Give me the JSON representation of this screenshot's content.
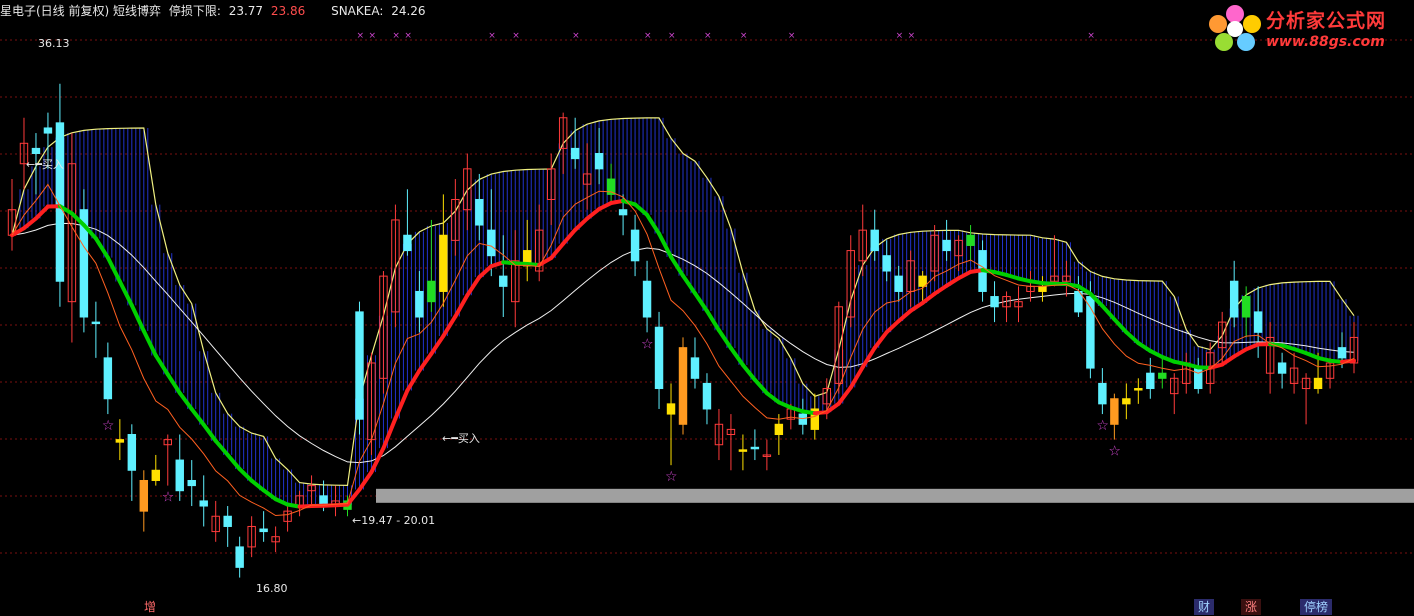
{
  "header": {
    "title": "星电子(日线 前复权) 短线博弈",
    "stop_label": "停损下限:",
    "stop_value_1": "23.77",
    "stop_value_2": "23.86",
    "snake_label": "SNAKEA:",
    "snake_value": "24.26"
  },
  "logo": {
    "brand": "分析家公式网",
    "url": "www.88gs.com"
  },
  "bottom_tabs": {
    "zeng": "增",
    "cai": "财",
    "zhang": "涨",
    "tingpai": "停榜"
  },
  "annotations": {
    "high": "36.13",
    "low": "16.80",
    "buy1": "←━买入",
    "buy2": "←━买入",
    "range": "←19.47 - 20.01"
  },
  "colors": {
    "background": "#000000",
    "up_candle": "#ff3b3b",
    "down_candle": "#5ff0ff",
    "green_band": "#00d000",
    "red_band": "#ff2020",
    "blue_fill": "#2233cc",
    "yellow_line": "#f0f080",
    "white_line": "#f0f0f0",
    "grid": "#7a1010",
    "floor_bar": "#a0a0a0",
    "star": "#cc44cc"
  },
  "chart_data": {
    "type": "candlestick",
    "title": "星电子(日线 前复权) 短线博弈",
    "ylim": [
      16,
      38
    ],
    "grid": true,
    "candles": [
      {
        "o": 31.2,
        "h": 32.4,
        "l": 29.6,
        "c": 30.2,
        "color": "up"
      },
      {
        "o": 33.0,
        "h": 34.8,
        "l": 32.0,
        "c": 33.8,
        "color": "up"
      },
      {
        "o": 33.4,
        "h": 34.2,
        "l": 31.8,
        "c": 33.6,
        "color": "cyan"
      },
      {
        "o": 34.2,
        "h": 35.0,
        "l": 32.8,
        "c": 34.4,
        "color": "cyan"
      },
      {
        "o": 34.6,
        "h": 36.13,
        "l": 27.4,
        "c": 28.4,
        "color": "cyan"
      },
      {
        "o": 33.0,
        "h": 34.2,
        "l": 26.0,
        "c": 27.6,
        "color": "up"
      },
      {
        "o": 31.2,
        "h": 32.0,
        "l": 26.4,
        "c": 27.0,
        "color": "cyan"
      },
      {
        "o": 26.8,
        "h": 27.6,
        "l": 25.4,
        "c": 26.8,
        "color": "cyan"
      },
      {
        "o": 25.4,
        "h": 26.0,
        "l": 23.2,
        "c": 23.8,
        "color": "cyan"
      },
      {
        "o": 22.2,
        "h": 23.0,
        "l": 21.4,
        "c": 22.1,
        "color": "yellow"
      },
      {
        "o": 21.0,
        "h": 22.8,
        "l": 19.8,
        "c": 22.4,
        "color": "cyan"
      },
      {
        "o": 19.4,
        "h": 21.0,
        "l": 18.6,
        "c": 20.6,
        "color": "orange"
      },
      {
        "o": 21.0,
        "h": 21.6,
        "l": 20.4,
        "c": 20.6,
        "color": "yellow"
      },
      {
        "o": 22.0,
        "h": 22.4,
        "l": 20.4,
        "c": 22.2,
        "color": "up"
      },
      {
        "o": 21.4,
        "h": 22.4,
        "l": 19.8,
        "c": 20.2,
        "color": "cyan"
      },
      {
        "o": 20.4,
        "h": 21.4,
        "l": 19.6,
        "c": 20.6,
        "color": "cyan"
      },
      {
        "o": 19.8,
        "h": 20.8,
        "l": 18.8,
        "c": 19.6,
        "color": "cyan"
      },
      {
        "o": 19.2,
        "h": 19.8,
        "l": 18.2,
        "c": 18.6,
        "color": "up"
      },
      {
        "o": 18.8,
        "h": 19.6,
        "l": 18.0,
        "c": 19.2,
        "color": "cyan"
      },
      {
        "o": 17.2,
        "h": 18.4,
        "l": 16.8,
        "c": 18.0,
        "color": "cyan"
      },
      {
        "o": 18.0,
        "h": 19.2,
        "l": 17.6,
        "c": 18.8,
        "color": "up"
      },
      {
        "o": 18.6,
        "h": 19.4,
        "l": 18.2,
        "c": 18.7,
        "color": "cyan"
      },
      {
        "o": 18.4,
        "h": 18.8,
        "l": 17.8,
        "c": 18.2,
        "color": "up"
      },
      {
        "o": 19.0,
        "h": 19.6,
        "l": 18.6,
        "c": 19.4,
        "color": "up"
      },
      {
        "o": 19.6,
        "h": 20.2,
        "l": 19.2,
        "c": 20.0,
        "color": "up"
      },
      {
        "o": 20.2,
        "h": 20.8,
        "l": 19.6,
        "c": 20.4,
        "color": "up"
      },
      {
        "o": 20.0,
        "h": 20.6,
        "l": 19.4,
        "c": 19.6,
        "color": "cyan"
      },
      {
        "o": 19.6,
        "h": 20.4,
        "l": 19.2,
        "c": 19.8,
        "color": "up"
      },
      {
        "o": 19.47,
        "h": 20.01,
        "l": 19.2,
        "c": 19.8,
        "color": "green"
      },
      {
        "o": 23.0,
        "h": 27.6,
        "l": 22.4,
        "c": 27.2,
        "color": "cyan"
      },
      {
        "o": 22.2,
        "h": 25.6,
        "l": 21.6,
        "c": 25.2,
        "color": "up"
      },
      {
        "o": 24.6,
        "h": 28.8,
        "l": 24.0,
        "c": 28.6,
        "color": "up"
      },
      {
        "o": 27.2,
        "h": 31.4,
        "l": 26.6,
        "c": 30.8,
        "color": "up"
      },
      {
        "o": 30.2,
        "h": 32.0,
        "l": 29.4,
        "c": 29.6,
        "color": "cyan"
      },
      {
        "o": 28.0,
        "h": 28.8,
        "l": 26.4,
        "c": 27.0,
        "color": "cyan"
      },
      {
        "o": 27.6,
        "h": 30.8,
        "l": 27.2,
        "c": 28.4,
        "color": "green"
      },
      {
        "o": 28.0,
        "h": 31.8,
        "l": 27.4,
        "c": 30.2,
        "color": "yellow"
      },
      {
        "o": 30.0,
        "h": 32.4,
        "l": 29.4,
        "c": 31.6,
        "color": "up"
      },
      {
        "o": 31.2,
        "h": 33.4,
        "l": 30.4,
        "c": 32.8,
        "color": "up"
      },
      {
        "o": 30.6,
        "h": 32.6,
        "l": 30.0,
        "c": 31.6,
        "color": "cyan"
      },
      {
        "o": 30.4,
        "h": 32.0,
        "l": 28.6,
        "c": 29.4,
        "color": "cyan"
      },
      {
        "o": 28.6,
        "h": 30.2,
        "l": 27.0,
        "c": 28.2,
        "color": "cyan"
      },
      {
        "o": 29.2,
        "h": 30.4,
        "l": 26.6,
        "c": 27.6,
        "color": "up"
      },
      {
        "o": 29.6,
        "h": 30.8,
        "l": 28.4,
        "c": 29.0,
        "color": "yellow"
      },
      {
        "o": 30.4,
        "h": 31.4,
        "l": 28.4,
        "c": 28.8,
        "color": "up"
      },
      {
        "o": 31.6,
        "h": 33.4,
        "l": 30.6,
        "c": 32.8,
        "color": "up"
      },
      {
        "o": 33.6,
        "h": 35.0,
        "l": 32.6,
        "c": 34.8,
        "color": "up"
      },
      {
        "o": 33.6,
        "h": 34.8,
        "l": 32.8,
        "c": 33.2,
        "color": "cyan"
      },
      {
        "o": 32.2,
        "h": 33.8,
        "l": 31.2,
        "c": 32.6,
        "color": "up"
      },
      {
        "o": 33.4,
        "h": 34.4,
        "l": 32.2,
        "c": 32.8,
        "color": "cyan"
      },
      {
        "o": 32.4,
        "h": 33.0,
        "l": 31.4,
        "c": 31.8,
        "color": "green"
      },
      {
        "o": 31.2,
        "h": 31.8,
        "l": 30.2,
        "c": 31.0,
        "color": "cyan"
      },
      {
        "o": 30.4,
        "h": 31.0,
        "l": 28.6,
        "c": 29.2,
        "color": "cyan"
      },
      {
        "o": 28.4,
        "h": 29.2,
        "l": 26.4,
        "c": 27.0,
        "color": "cyan"
      },
      {
        "o": 26.6,
        "h": 27.2,
        "l": 23.4,
        "c": 24.2,
        "color": "cyan"
      },
      {
        "o": 23.6,
        "h": 24.4,
        "l": 21.2,
        "c": 23.2,
        "color": "yellow"
      },
      {
        "o": 22.8,
        "h": 26.2,
        "l": 22.4,
        "c": 25.8,
        "color": "orange"
      },
      {
        "o": 25.4,
        "h": 26.2,
        "l": 24.2,
        "c": 24.6,
        "color": "cyan"
      },
      {
        "o": 24.4,
        "h": 24.8,
        "l": 22.8,
        "c": 23.4,
        "color": "cyan"
      },
      {
        "o": 22.8,
        "h": 23.4,
        "l": 21.4,
        "c": 22.0,
        "color": "up"
      },
      {
        "o": 22.6,
        "h": 23.2,
        "l": 21.0,
        "c": 22.4,
        "color": "up"
      },
      {
        "o": 21.8,
        "h": 22.4,
        "l": 21.0,
        "c": 21.8,
        "color": "yellow"
      },
      {
        "o": 21.9,
        "h": 22.6,
        "l": 21.4,
        "c": 21.9,
        "color": "cyan"
      },
      {
        "o": 21.6,
        "h": 22.2,
        "l": 21.0,
        "c": 21.6,
        "color": "up"
      },
      {
        "o": 22.4,
        "h": 23.2,
        "l": 21.6,
        "c": 22.8,
        "color": "yellow"
      },
      {
        "o": 23.0,
        "h": 23.6,
        "l": 22.6,
        "c": 23.4,
        "color": "up"
      },
      {
        "o": 23.2,
        "h": 23.8,
        "l": 22.4,
        "c": 22.8,
        "color": "cyan"
      },
      {
        "o": 22.6,
        "h": 24.0,
        "l": 22.2,
        "c": 23.4,
        "color": "yellow"
      },
      {
        "o": 23.6,
        "h": 24.6,
        "l": 23.0,
        "c": 24.2,
        "color": "up"
      },
      {
        "o": 24.4,
        "h": 27.6,
        "l": 24.0,
        "c": 27.4,
        "color": "up"
      },
      {
        "o": 27.0,
        "h": 30.2,
        "l": 26.6,
        "c": 29.6,
        "color": "up"
      },
      {
        "o": 29.2,
        "h": 31.4,
        "l": 28.6,
        "c": 30.4,
        "color": "up"
      },
      {
        "o": 30.4,
        "h": 31.2,
        "l": 29.2,
        "c": 29.6,
        "color": "cyan"
      },
      {
        "o": 29.4,
        "h": 30.0,
        "l": 28.4,
        "c": 28.8,
        "color": "cyan"
      },
      {
        "o": 28.6,
        "h": 29.0,
        "l": 27.6,
        "c": 28.0,
        "color": "cyan"
      },
      {
        "o": 28.0,
        "h": 29.6,
        "l": 27.4,
        "c": 29.2,
        "color": "up"
      },
      {
        "o": 28.2,
        "h": 28.8,
        "l": 27.6,
        "c": 28.6,
        "color": "yellow"
      },
      {
        "o": 28.8,
        "h": 30.6,
        "l": 28.4,
        "c": 30.2,
        "color": "up"
      },
      {
        "o": 30.0,
        "h": 30.8,
        "l": 29.2,
        "c": 29.6,
        "color": "cyan"
      },
      {
        "o": 29.4,
        "h": 30.2,
        "l": 28.8,
        "c": 30.0,
        "color": "up"
      },
      {
        "o": 30.2,
        "h": 30.6,
        "l": 29.2,
        "c": 29.8,
        "color": "green"
      },
      {
        "o": 29.6,
        "h": 30.0,
        "l": 27.6,
        "c": 28.0,
        "color": "cyan"
      },
      {
        "o": 27.8,
        "h": 28.4,
        "l": 26.8,
        "c": 27.4,
        "color": "cyan"
      },
      {
        "o": 27.4,
        "h": 28.0,
        "l": 26.8,
        "c": 27.8,
        "color": "up"
      },
      {
        "o": 27.4,
        "h": 28.2,
        "l": 26.8,
        "c": 27.6,
        "color": "up"
      },
      {
        "o": 28.2,
        "h": 28.8,
        "l": 27.6,
        "c": 28.0,
        "color": "up"
      },
      {
        "o": 28.0,
        "h": 28.6,
        "l": 27.6,
        "c": 28.2,
        "color": "yellow"
      },
      {
        "o": 28.6,
        "h": 30.2,
        "l": 28.2,
        "c": 28.4,
        "color": "up"
      },
      {
        "o": 28.6,
        "h": 29.2,
        "l": 27.8,
        "c": 28.4,
        "color": "up"
      },
      {
        "o": 28.0,
        "h": 28.6,
        "l": 27.0,
        "c": 27.2,
        "color": "cyan"
      },
      {
        "o": 27.8,
        "h": 28.4,
        "l": 24.6,
        "c": 25.0,
        "color": "cyan"
      },
      {
        "o": 24.4,
        "h": 25.0,
        "l": 23.2,
        "c": 23.6,
        "color": "cyan"
      },
      {
        "o": 22.8,
        "h": 24.0,
        "l": 22.2,
        "c": 23.8,
        "color": "orange"
      },
      {
        "o": 23.6,
        "h": 24.4,
        "l": 23.0,
        "c": 23.8,
        "color": "yellow"
      },
      {
        "o": 24.2,
        "h": 24.6,
        "l": 23.6,
        "c": 24.2,
        "color": "yellow"
      },
      {
        "o": 24.2,
        "h": 25.4,
        "l": 23.8,
        "c": 24.8,
        "color": "cyan"
      },
      {
        "o": 24.8,
        "h": 25.4,
        "l": 24.2,
        "c": 24.6,
        "color": "green"
      },
      {
        "o": 24.0,
        "h": 24.8,
        "l": 23.2,
        "c": 24.6,
        "color": "up"
      },
      {
        "o": 24.4,
        "h": 25.6,
        "l": 24.0,
        "c": 25.2,
        "color": "up"
      },
      {
        "o": 25.0,
        "h": 25.4,
        "l": 24.0,
        "c": 24.2,
        "color": "cyan"
      },
      {
        "o": 24.4,
        "h": 26.0,
        "l": 24.0,
        "c": 25.6,
        "color": "up"
      },
      {
        "o": 25.8,
        "h": 27.2,
        "l": 25.2,
        "c": 26.8,
        "color": "up"
      },
      {
        "o": 27.0,
        "h": 29.2,
        "l": 26.6,
        "c": 28.4,
        "color": "cyan"
      },
      {
        "o": 27.8,
        "h": 28.2,
        "l": 26.2,
        "c": 27.0,
        "color": "green"
      },
      {
        "o": 27.2,
        "h": 28.2,
        "l": 25.4,
        "c": 26.4,
        "color": "cyan"
      },
      {
        "o": 26.2,
        "h": 26.8,
        "l": 24.0,
        "c": 24.8,
        "color": "up"
      },
      {
        "o": 24.8,
        "h": 25.6,
        "l": 24.2,
        "c": 25.2,
        "color": "cyan"
      },
      {
        "o": 25.0,
        "h": 25.6,
        "l": 24.0,
        "c": 24.4,
        "color": "up"
      },
      {
        "o": 24.2,
        "h": 24.8,
        "l": 22.8,
        "c": 24.6,
        "color": "up"
      },
      {
        "o": 24.6,
        "h": 25.6,
        "l": 24.0,
        "c": 24.2,
        "color": "yellow"
      },
      {
        "o": 24.6,
        "h": 25.4,
        "l": 24.2,
        "c": 25.2,
        "color": "up"
      },
      {
        "o": 25.8,
        "h": 26.4,
        "l": 25.0,
        "c": 25.4,
        "color": "cyan"
      },
      {
        "o": 25.2,
        "h": 26.8,
        "l": 24.8,
        "c": 26.2,
        "color": "up"
      }
    ],
    "stars": [
      8,
      13,
      53,
      55,
      91,
      92
    ],
    "purple_marks": [
      29,
      30,
      32,
      33,
      40,
      42,
      47,
      53,
      55,
      58,
      61,
      65,
      74,
      75,
      90
    ]
  }
}
